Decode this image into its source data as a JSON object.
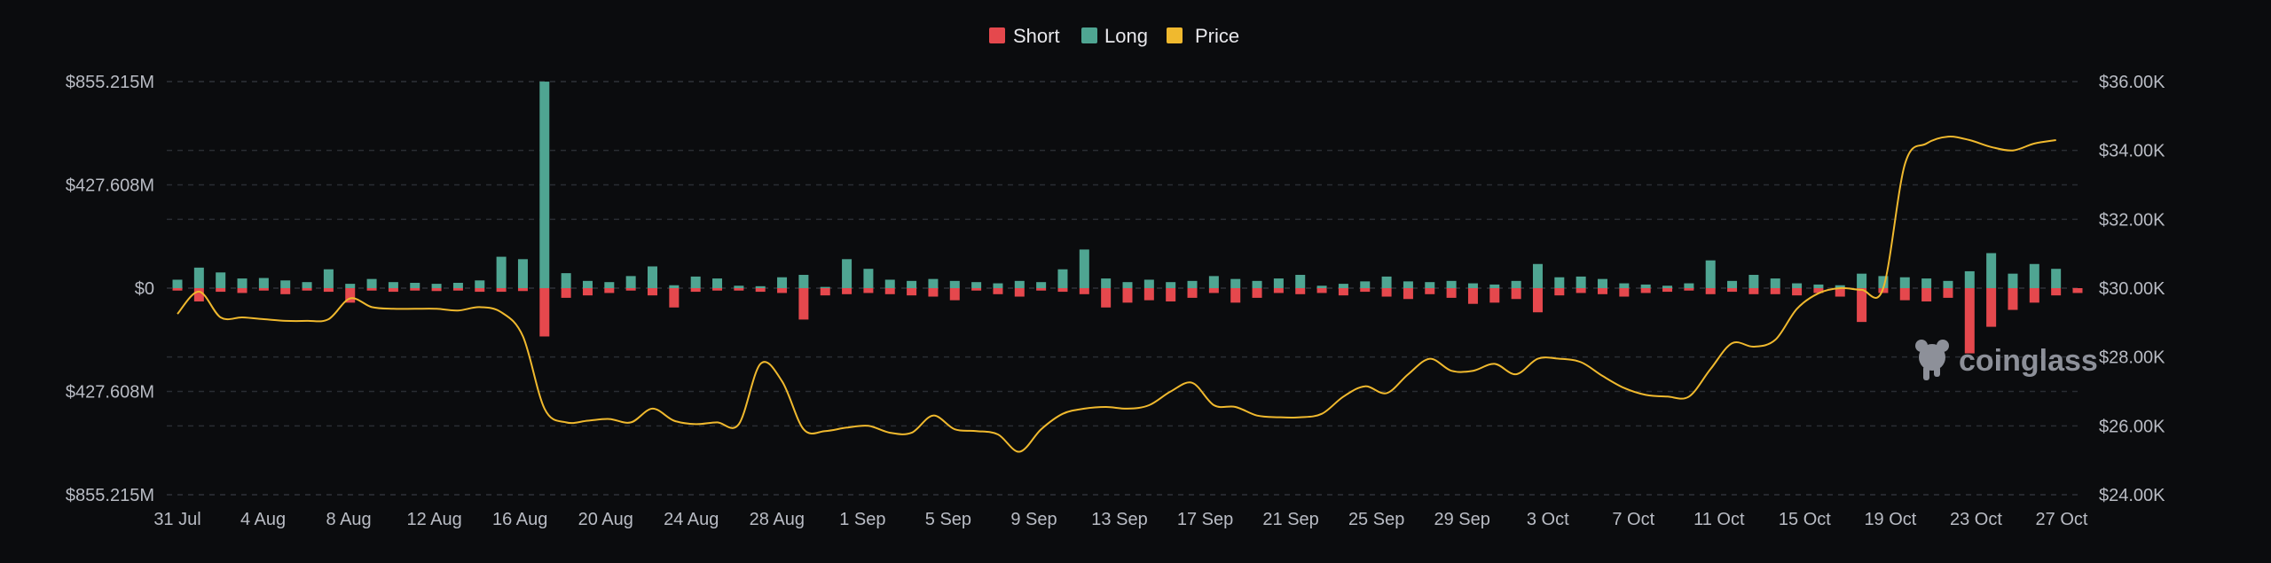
{
  "chart_data": {
    "type": "bar",
    "title": "",
    "legend": {
      "placement": "top-center",
      "items": [
        {
          "name": "Short",
          "color": "#e5484d"
        },
        {
          "name": "Long",
          "color": "#4fa592"
        },
        {
          "name": "Price",
          "color": "#f0b92e"
        }
      ]
    },
    "watermark": "coinglass",
    "y_left": {
      "range": [
        -855.215,
        855.215
      ],
      "unit": "M",
      "tick_values": [
        855.215,
        427.608,
        0,
        -427.608,
        -855.215
      ],
      "tick_labels": [
        "$855.215M",
        "$427.608M",
        "$0",
        "$427.608M",
        "$855.215M"
      ]
    },
    "y_right": {
      "range": [
        24000,
        36000
      ],
      "tick_values": [
        36000,
        34000,
        32000,
        30000,
        28000,
        26000,
        24000
      ],
      "tick_labels": [
        "$36.00K",
        "$34.00K",
        "$32.00K",
        "$30.00K",
        "$28.00K",
        "$26.00K",
        "$24.00K"
      ]
    },
    "x_axis": {
      "start_date": "31 Jul",
      "tick_labels": [
        "31 Jul",
        "4 Aug",
        "8 Aug",
        "12 Aug",
        "16 Aug",
        "20 Aug",
        "24 Aug",
        "28 Aug",
        "1 Sep",
        "5 Sep",
        "9 Sep",
        "13 Sep",
        "17 Sep",
        "21 Sep",
        "25 Sep",
        "29 Sep",
        "3 Oct",
        "7 Oct",
        "11 Oct",
        "15 Oct",
        "19 Oct",
        "23 Oct",
        "27 Oct"
      ]
    },
    "grid": true,
    "series": [
      {
        "name": "Long",
        "color": "#4fa592",
        "values": [
          35,
          85,
          65,
          40,
          42,
          32,
          25,
          78,
          18,
          38,
          25,
          22,
          18,
          22,
          32,
          130,
          120,
          855,
          62,
          30,
          25,
          50,
          90,
          12,
          48,
          40,
          10,
          8,
          45,
          55,
          5,
          120,
          80,
          35,
          30,
          38,
          30,
          25,
          20,
          30,
          25,
          78,
          160,
          40,
          25,
          35,
          25,
          30,
          50,
          38,
          30,
          40,
          55,
          10,
          18,
          28,
          48,
          28,
          25,
          30,
          20,
          15,
          30,
          100,
          45,
          48,
          38,
          20,
          15,
          10,
          20,
          115,
          30,
          55,
          40,
          20,
          15,
          12,
          60,
          50,
          45,
          40,
          30,
          70,
          145,
          60,
          100,
          80
        ]
      },
      {
        "name": "Short",
        "color": "#e5484d",
        "values": [
          -10,
          -55,
          -15,
          -20,
          -10,
          -25,
          -10,
          -15,
          -60,
          -10,
          -15,
          -10,
          -12,
          -10,
          -15,
          -15,
          -12,
          -200,
          -40,
          -30,
          -20,
          -10,
          -30,
          -80,
          -15,
          -10,
          -10,
          -15,
          -20,
          -130,
          -30,
          -25,
          -20,
          -25,
          -30,
          -35,
          -50,
          -10,
          -25,
          -35,
          -10,
          -15,
          -25,
          -80,
          -60,
          -50,
          -55,
          -40,
          -20,
          -60,
          -40,
          -20,
          -25,
          -20,
          -30,
          -15,
          -35,
          -45,
          -25,
          -40,
          -65,
          -60,
          -45,
          -100,
          -30,
          -20,
          -25,
          -35,
          -20,
          -15,
          -10,
          -25,
          -15,
          -25,
          -25,
          -30,
          -20,
          -35,
          -140,
          -20,
          -50,
          -55,
          -40,
          -270,
          -160,
          -90,
          -60,
          -30,
          -20
        ]
      },
      {
        "name": "Price",
        "color": "#f0b92e",
        "values": [
          29250,
          29900,
          29150,
          29150,
          29100,
          29050,
          29050,
          29100,
          29700,
          29450,
          29400,
          29400,
          29400,
          29350,
          29450,
          29300,
          28600,
          26500,
          26100,
          26150,
          26200,
          26100,
          26500,
          26150,
          26050,
          26100,
          26050,
          27800,
          27300,
          25900,
          25850,
          25950,
          26000,
          25800,
          25800,
          26300,
          25900,
          25850,
          25750,
          25250,
          25900,
          26350,
          26500,
          26550,
          26500,
          26600,
          27000,
          27250,
          26600,
          26550,
          26300,
          26250,
          26250,
          26350,
          26850,
          27150,
          26950,
          27500,
          27950,
          27600,
          27600,
          27800,
          27500,
          27950,
          27950,
          27850,
          27450,
          27100,
          26900,
          26850,
          26850,
          27650,
          28400,
          28300,
          28500,
          29400,
          29850,
          30000,
          29950,
          30000,
          33600,
          34200,
          34400,
          34300,
          34100,
          34000,
          34200,
          34300
        ]
      }
    ]
  }
}
